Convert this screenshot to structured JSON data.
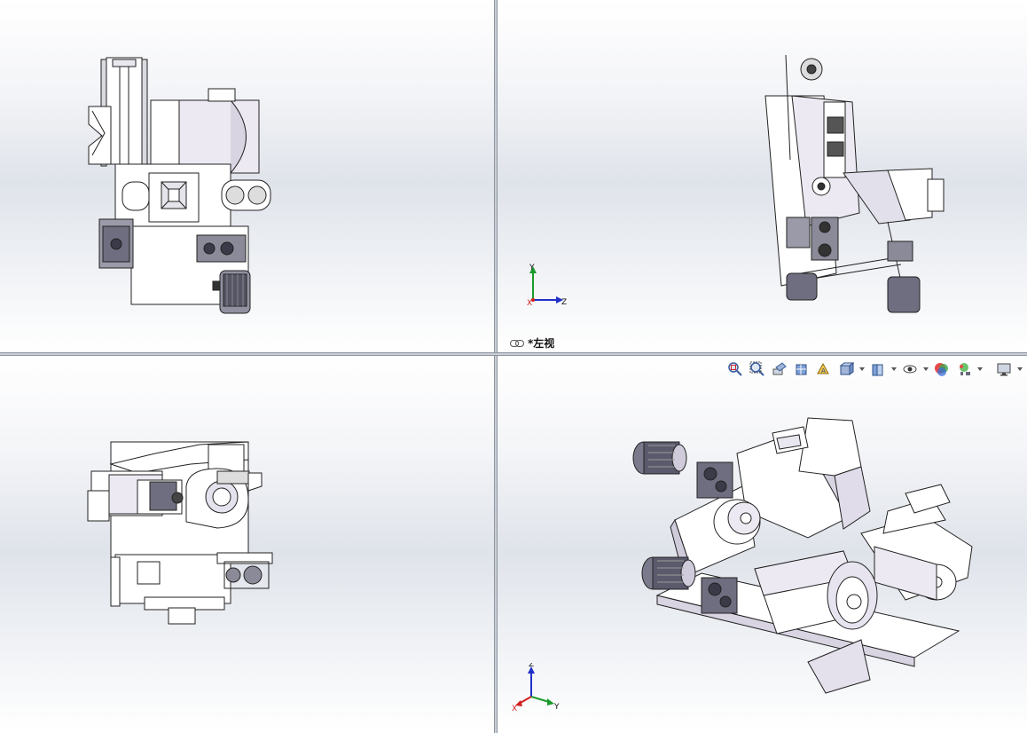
{
  "viewports": {
    "top_right": {
      "view_name": "*左视"
    },
    "bottom_right": {
      "view_name": ""
    }
  },
  "triads": {
    "top_right": {
      "y": "Y",
      "z": "Z",
      "x": "X"
    },
    "bottom_right": {
      "z": "Z",
      "x": "X",
      "y": "Y"
    }
  },
  "toolbar": {
    "icons": [
      "zoom-to-fit-icon",
      "zoom-to-area-icon",
      "previous-view-icon",
      "section-view-icon",
      "dynamic-annotation-views-icon",
      "view-orientation-icon",
      "display-style-icon",
      "hide-show-items-icon",
      "edit-appearance-icon",
      "apply-scene-icon",
      "view-settings-icon"
    ]
  },
  "colors": {
    "axis_x": "#d02020",
    "axis_y": "#1c9a2c",
    "axis_z": "#2030c8",
    "part_fill": "#ffffff",
    "part_shade": "#c8c4d4",
    "edge": "#222222"
  }
}
